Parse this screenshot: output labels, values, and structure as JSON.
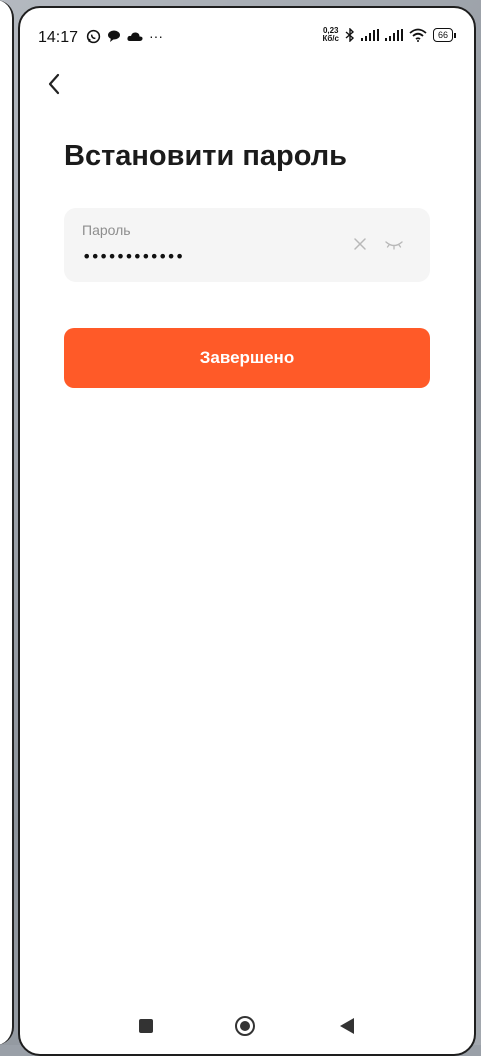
{
  "status_bar": {
    "time": "14:17",
    "net_speed_value": "0,23",
    "net_speed_unit": "Кб/с",
    "battery": "66",
    "ellipsis": "···"
  },
  "header": {
    "back_icon": "chevron-left-icon",
    "title": "Встановити пароль"
  },
  "password_field": {
    "label": "Пароль",
    "value": "••••••••••••",
    "clear_icon": "close-icon",
    "visibility_icon": "eye-closed-icon"
  },
  "actions": {
    "done_label": "Завершено"
  },
  "colors": {
    "accent": "#ff5a28",
    "field_bg": "#f5f5f5",
    "title_text": "#1b1b1b",
    "label_text": "#8e8e8e"
  },
  "system_nav": {
    "recents_icon": "square-icon",
    "home_icon": "circle-icon",
    "back_icon": "triangle-back-icon"
  }
}
